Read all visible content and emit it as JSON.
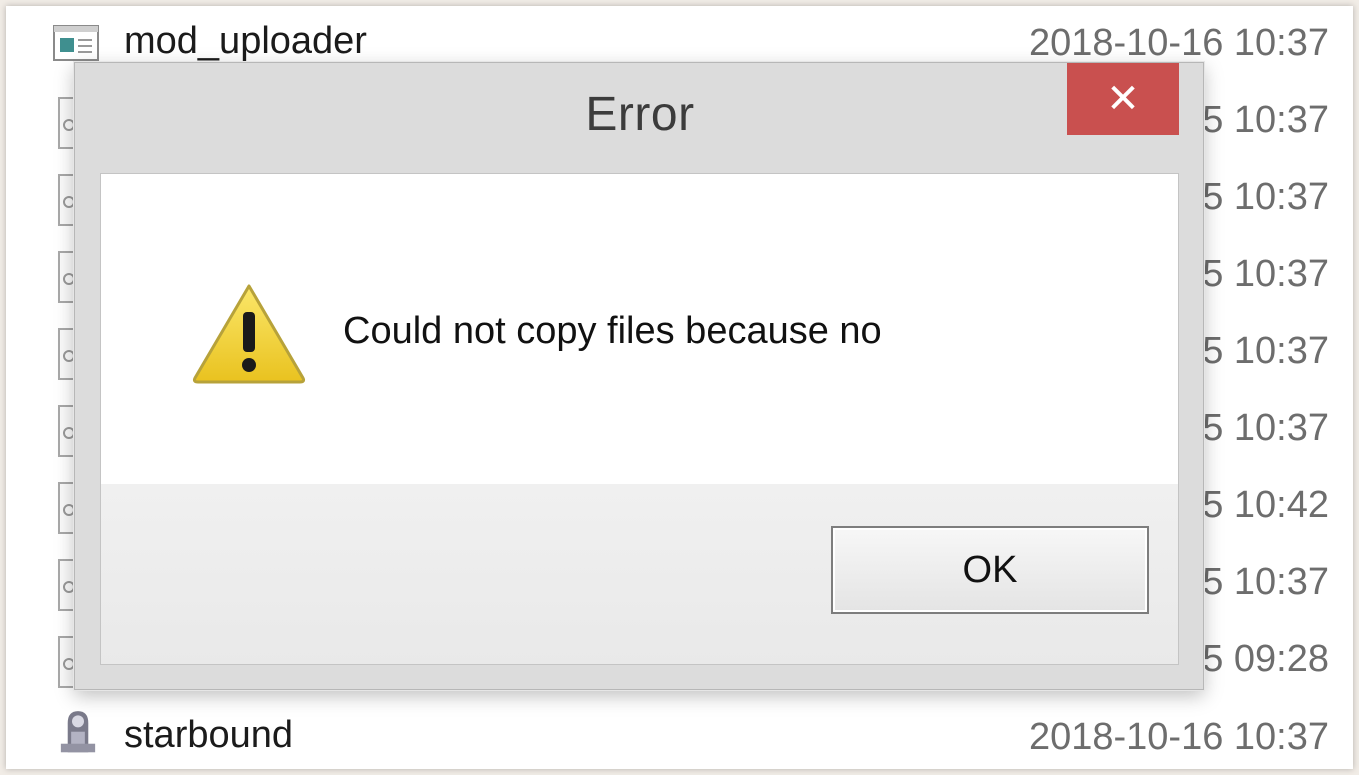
{
  "explorer": {
    "rows": [
      {
        "name": "mod_uploader",
        "date": "2018-10-16 10:37"
      },
      {
        "date": "5 10:37"
      },
      {
        "date": "5 10:37"
      },
      {
        "date": "5 10:37"
      },
      {
        "date": "5 10:37"
      },
      {
        "date": "5 10:37"
      },
      {
        "date": "5 10:42"
      },
      {
        "date": "5 10:37"
      },
      {
        "date": "5 09:28"
      },
      {
        "name": "starbound",
        "date": "2018-10-16 10:37"
      }
    ],
    "icons": {
      "app_icon": "application-window-icon",
      "file_icon": "config-file-icon",
      "game_icon": "starbound-app-icon"
    }
  },
  "dialog": {
    "title": "Error",
    "close_glyph": "✕",
    "message": "Could not copy files because no",
    "icon": "warning-icon",
    "ok_label": "OK",
    "colors": {
      "close_button": "#c9504f",
      "warning_fill": "#f2d13c"
    }
  }
}
